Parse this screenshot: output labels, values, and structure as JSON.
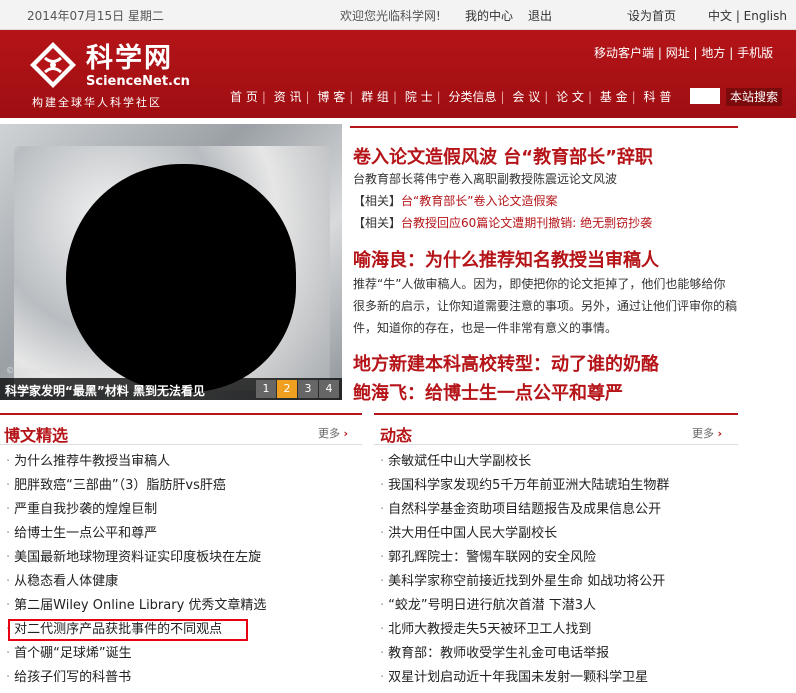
{
  "topbar": {
    "date": "2014年07月15日 星期二",
    "welcome": "欢迎您光临科学网!",
    "my_center": "我的中心",
    "logout": "退出",
    "set_home": "设为首页",
    "lang": "中文 | English"
  },
  "header": {
    "logo_cn": "科学网",
    "logo_en": "ScienceNet.cn",
    "slogan": "构建全球华人科学社区",
    "quicklinks": [
      "移动客户端",
      "网址",
      "地方",
      "手机版"
    ],
    "nav": [
      "首 页",
      "资 讯",
      "博 客",
      "群 组",
      "院 士",
      "分类信息",
      "会 议",
      "论 文",
      "基 金",
      "科 普"
    ],
    "search_button": "本站搜索"
  },
  "feature": {
    "caption": "科学家发明“最黑”材料 黑到无法看见",
    "credit": "© surreynanosystems",
    "pages": [
      "1",
      "2",
      "3",
      "4"
    ],
    "active_page": 2
  },
  "headlines": {
    "h1": "卷入论文造假风波 台“教育部长”辞职",
    "h1_sub": "台教育部长蒋伟宁卷入离职副教授陈震远论文风波",
    "related1_tag": "【相关】",
    "related1": "台“教育部长”卷入论文造假案",
    "related2_tag": "【相关】",
    "related2": "台教授回应60篇论文遭期刊撤销: 绝无剽窃抄袭",
    "h2": "喻海良：为什么推荐知名教授当审稿人",
    "h2_para": "推荐“牛”人做审稿人。因为，即使把你的论文拒掉了，他们也能够给你很多新的启示，让你知道需要注意的事项。另外，通过让他们评审你的稿件，知道你的存在，也是一件非常有意义的事情。",
    "h3": "地方新建本科高校转型：动了谁的奶酪",
    "h4": "鲍海飞：给博士生一点公平和尊严"
  },
  "blog": {
    "title": "博文精选",
    "more": "更多",
    "items": [
      "为什么推荐牛教授当审稿人",
      "肥胖致癌“三部曲”（3）脂肪肝vs肝癌",
      "严重自我抄袭的煌煌巨制",
      "给博士生一点公平和尊严",
      "美国最新地球物理资料证实印度板块在左旋",
      "从稳态看人体健康",
      "第二届Wiley Online Library 优秀文章精选",
      "对二代测序产品获批事件的不同观点",
      "首个硼“足球烯”诞生",
      "给孩子们写的科普书"
    ]
  },
  "news": {
    "title": "动态",
    "more": "更多",
    "items": [
      "余敏斌任中山大学副校长",
      "我国科学家发现约5千万年前亚洲大陆琥珀生物群",
      "自然科学基金资助项目结题报告及成果信息公开",
      "洪大用任中国人民大学副校长",
      "郭孔辉院士：警惕车联网的安全风险",
      "美科学家称空前接近找到外星生命 如战功将公开",
      "“蛟龙”号明日进行航次首潜 下潜3人",
      "北师大教授走失5天被环卫工人找到",
      "教育部：教师收受学生礼金可电话举报",
      "双星计划启动近十年我国未发射一颗科学卫星"
    ]
  }
}
